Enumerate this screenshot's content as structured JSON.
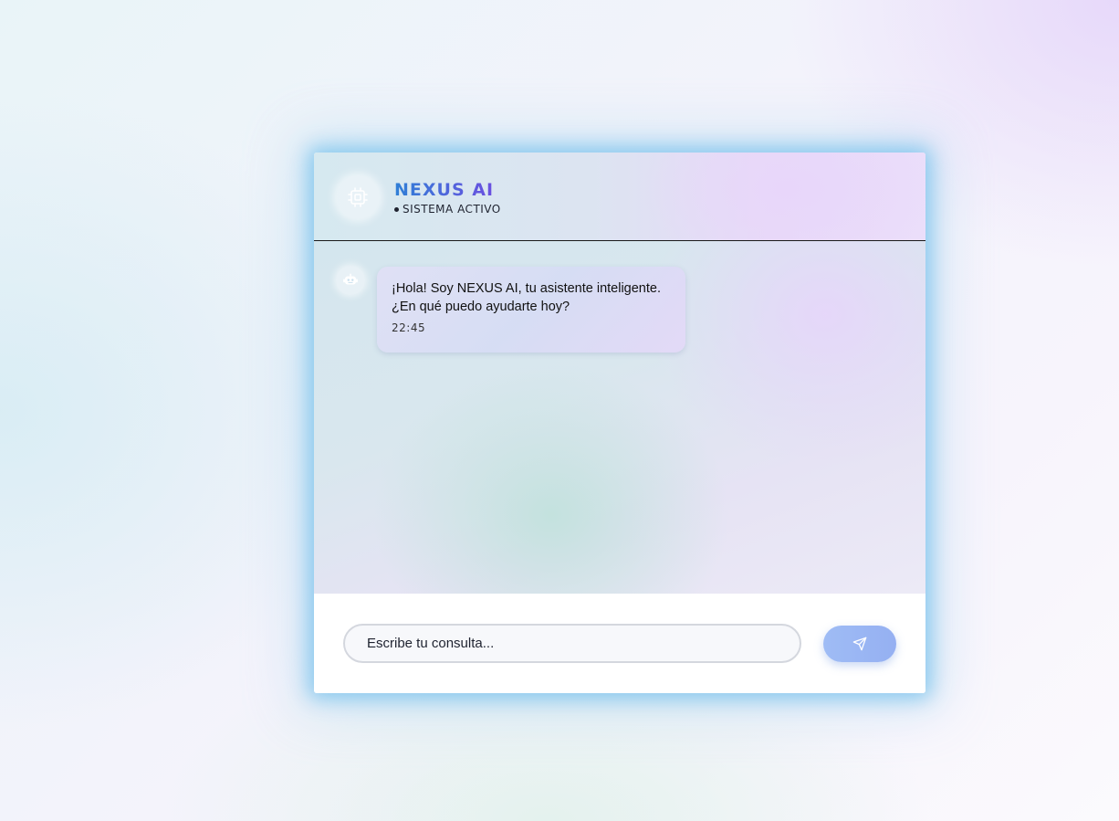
{
  "header": {
    "title": "NEXUS AI",
    "status": "SISTEMA ACTIVO",
    "avatar_icon": "chip-icon"
  },
  "messages": [
    {
      "sender": "bot",
      "avatar_icon": "robot-icon",
      "text": "¡Hola! Soy NEXUS AI, tu asistente inteligente.\n¿En qué puedo ayudarte hoy?",
      "time": "22:45"
    }
  ],
  "composer": {
    "placeholder": "Escribe tu consulta...",
    "value": "",
    "send_icon": "send-icon"
  },
  "colors": {
    "title_gradient_start": "#2f7fd6",
    "title_gradient_end": "#6b4fe0",
    "send_button": "#9fbcf5",
    "glow": "#6ebeeb"
  }
}
